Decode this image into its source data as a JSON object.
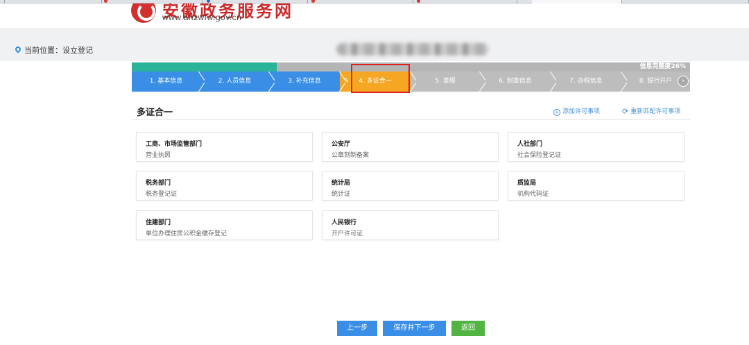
{
  "header": {
    "logo_title": "安徽政务服务网",
    "logo_url": "www.ahzwfw.gov.cn"
  },
  "location": {
    "label": "当前位置：设立登记"
  },
  "progress": {
    "label": "信息完整度26%",
    "value": 0.26
  },
  "steps": [
    {
      "label": "1. 基本信息",
      "state": "done"
    },
    {
      "label": "2. 人员信息",
      "state": "done"
    },
    {
      "label": "3. 补充信息",
      "state": "done"
    },
    {
      "label": "4. 多证合一",
      "state": "current"
    },
    {
      "label": "5. 章程",
      "state": "todo"
    },
    {
      "label": "6. 刻章信息",
      "state": "todo"
    },
    {
      "label": "7. 办税信息",
      "state": "todo"
    },
    {
      "label": "8. 银行开户",
      "state": "todo"
    }
  ],
  "section": {
    "title": "多证合一",
    "add_label": "添加许可事项",
    "rematch_label": "重新匹配许可事项"
  },
  "cards": [
    {
      "dept": "工商、市场监管部门",
      "cert": "营业执照"
    },
    {
      "dept": "公安厅",
      "cert": "公章刻制备案"
    },
    {
      "dept": "人社部门",
      "cert": "社会保险登记证"
    },
    {
      "dept": "税务部门",
      "cert": "税务登记证"
    },
    {
      "dept": "统计局",
      "cert": "统计证"
    },
    {
      "dept": "质监局",
      "cert": "机构代码证"
    },
    {
      "dept": "住建部门",
      "cert": "单位办理住房公积金缴存登记"
    },
    {
      "dept": "人民银行",
      "cert": "开户许可证"
    }
  ],
  "buttons": {
    "prev": "上一步",
    "save_next": "保存并下一步",
    "back": "返回"
  },
  "colors": {
    "done": "#3a8ee6",
    "current": "#f5a623",
    "todo": "#bdbdbd",
    "progress_fill": "#2bb39a",
    "back_button": "#52b443"
  }
}
